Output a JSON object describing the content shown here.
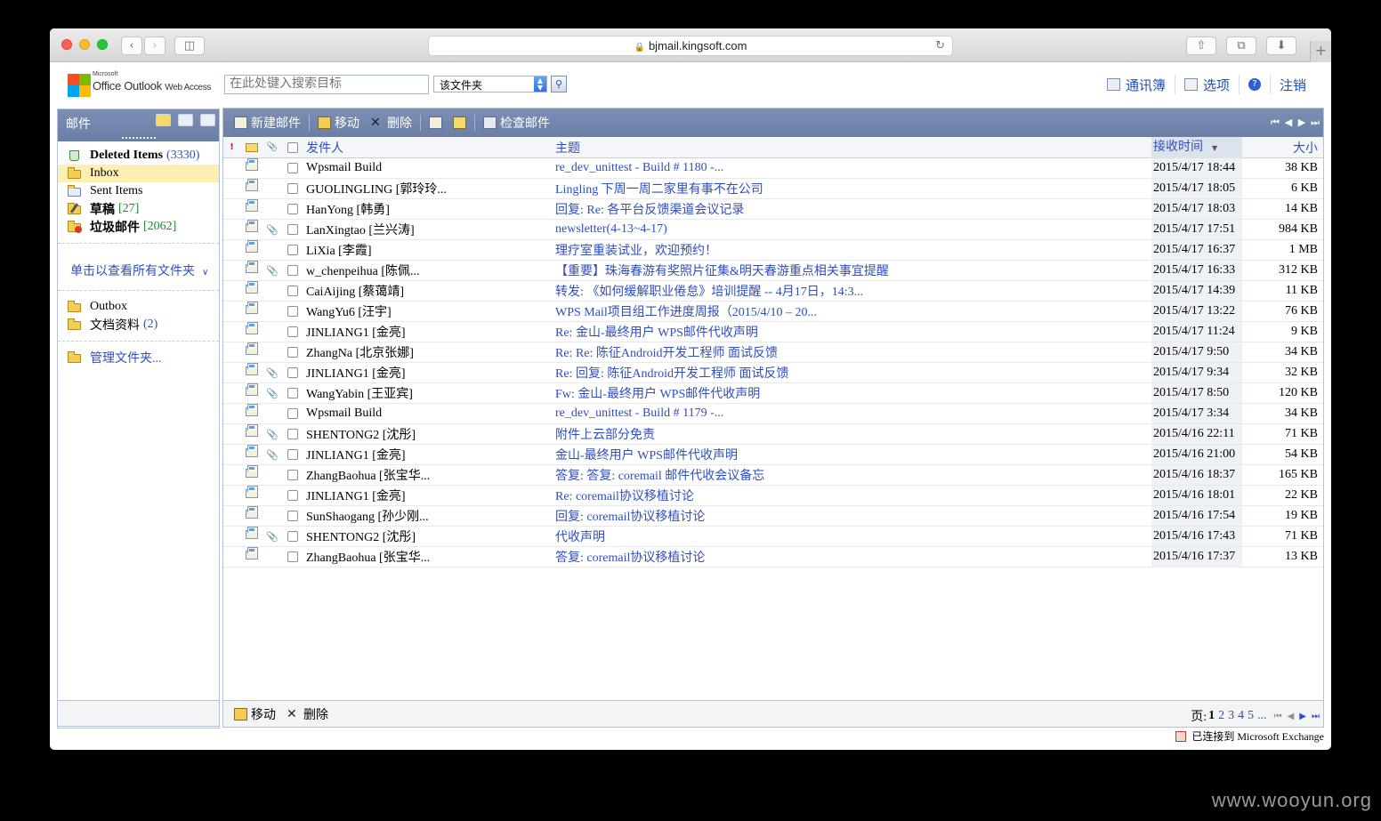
{
  "browser": {
    "url": "bjmail.kingsoft.com"
  },
  "brand": {
    "ms_label": "Microsoft",
    "name": "Office Outlook",
    "sub": "Web Access"
  },
  "search": {
    "placeholder": "在此处键入搜索目标",
    "scope": "该文件夹"
  },
  "top_links": [
    {
      "label": "通讯簿",
      "icon": "address-book-icon"
    },
    {
      "label": "选项",
      "icon": "options-icon"
    },
    {
      "label": "",
      "icon": "help-icon"
    },
    {
      "label": "注销",
      "icon": ""
    }
  ],
  "leftnav": {
    "title": "邮件",
    "folders": [
      {
        "name": "Deleted Items",
        "count": "(3330)",
        "bold": true,
        "icon": "recycle-bin-icon",
        "count_color": "blue"
      },
      {
        "name": "Inbox",
        "count": "",
        "bold": false,
        "selected": true,
        "icon": "inbox-icon"
      },
      {
        "name": "Sent Items",
        "count": "",
        "bold": false,
        "icon": "sent-items-icon"
      },
      {
        "name": "草稿",
        "count": "[27]",
        "bold": true,
        "icon": "drafts-icon",
        "count_color": "green"
      },
      {
        "name": "垃圾邮件",
        "count": "[2062]",
        "bold": true,
        "icon": "junk-mail-icon",
        "count_color": "green"
      }
    ],
    "all_folders_label": "单击以查看所有文件夹",
    "extra_folders": [
      {
        "name": "Outbox",
        "count": "",
        "icon": "folder-icon"
      },
      {
        "name": "文档资料",
        "count": "(2)",
        "icon": "folder-icon"
      }
    ],
    "manage_label": "管理文件夹..."
  },
  "toolbar": {
    "new_mail": "新建邮件",
    "move": "移动",
    "delete": "删除",
    "check_mail": "检查邮件"
  },
  "columns": {
    "from": "发件人",
    "subject": "主题",
    "received": "接收时间",
    "size": "大小"
  },
  "messages": [
    {
      "from": "Wpsmail Build",
      "subject": "re_dev_unittest - Build # 1180 -...",
      "date": "2015/4/17 18:44",
      "size": "38 KB",
      "attach": false
    },
    {
      "from": "GUOLINGLING [郭玲玲...",
      "subject": "Lingling 下周一周二家里有事不在公司",
      "date": "2015/4/17 18:05",
      "size": "6 KB",
      "attach": false
    },
    {
      "from": "HanYong [韩勇]",
      "subject": "回复: Re: 各平台反馈渠道会议记录",
      "date": "2015/4/17 18:03",
      "size": "14 KB",
      "attach": false
    },
    {
      "from": "LanXingtao [兰兴涛]",
      "subject": "newsletter(4-13~4-17)",
      "date": "2015/4/17 17:51",
      "size": "984 KB",
      "attach": true
    },
    {
      "from": "LiXia [李霞]",
      "subject": "理疗室重装试业，欢迎预约！",
      "date": "2015/4/17 16:37",
      "size": "1 MB",
      "attach": false
    },
    {
      "from": "w_chenpeihua [陈佩...",
      "subject": "【重要】珠海春游有奖照片征集&明天春游重点相关事宜提醒",
      "date": "2015/4/17 16:33",
      "size": "312 KB",
      "attach": true
    },
    {
      "from": "CaiAijing [蔡蔼靖]",
      "subject": "转发: 《如何缓解职业倦怠》培训提醒 -- 4月17日，14:3...",
      "date": "2015/4/17 14:39",
      "size": "11 KB",
      "attach": false
    },
    {
      "from": "WangYu6 [汪宇]",
      "subject": "WPS Mail项目组工作进度周报（2015/4/10 – 20...",
      "date": "2015/4/17 13:22",
      "size": "76 KB",
      "attach": false
    },
    {
      "from": "JINLIANG1 [金亮]",
      "subject": "Re: 金山-最终用户 WPS邮件代收声明",
      "date": "2015/4/17 11:24",
      "size": "9 KB",
      "attach": false
    },
    {
      "from": "ZhangNa [北京张娜]",
      "subject": "Re: Re: 陈征Android开发工程师 面试反馈",
      "date": "2015/4/17 9:50",
      "size": "34 KB",
      "attach": false
    },
    {
      "from": "JINLIANG1 [金亮]",
      "subject": "Re: 回复: 陈征Android开发工程师 面试反馈",
      "date": "2015/4/17 9:34",
      "size": "32 KB",
      "attach": true
    },
    {
      "from": "WangYabin [王亚宾]",
      "subject": "Fw: 金山-最终用户 WPS邮件代收声明",
      "date": "2015/4/17 8:50",
      "size": "120 KB",
      "attach": true
    },
    {
      "from": "Wpsmail Build",
      "subject": "re_dev_unittest - Build # 1179 -...",
      "date": "2015/4/17 3:34",
      "size": "34 KB",
      "attach": false
    },
    {
      "from": "SHENTONG2 [沈彤]",
      "subject": "附件上云部分免责",
      "date": "2015/4/16 22:11",
      "size": "71 KB",
      "attach": true
    },
    {
      "from": "JINLIANG1 [金亮]",
      "subject": "金山-最终用户 WPS邮件代收声明",
      "date": "2015/4/16 21:00",
      "size": "54 KB",
      "attach": true
    },
    {
      "from": "ZhangBaohua [张宝华...",
      "subject": "答复: 答复: coremail 邮件代收会议备忘",
      "date": "2015/4/16 18:37",
      "size": "165 KB",
      "attach": false
    },
    {
      "from": "JINLIANG1 [金亮]",
      "subject": "Re: coremail协议移植讨论",
      "date": "2015/4/16 18:01",
      "size": "22 KB",
      "attach": false
    },
    {
      "from": "SunShaogang [孙少刚...",
      "subject": "回复: coremail协议移植讨论",
      "date": "2015/4/16 17:54",
      "size": "19 KB",
      "attach": false
    },
    {
      "from": "SHENTONG2 [沈彤]",
      "subject": "代收声明",
      "date": "2015/4/16 17:43",
      "size": "71 KB",
      "attach": true
    },
    {
      "from": "ZhangBaohua [张宝华...",
      "subject": "答复: coremail协议移植讨论",
      "date": "2015/4/16 17:37",
      "size": "13 KB",
      "attach": false
    }
  ],
  "bottom": {
    "move": "移动",
    "delete": "删除",
    "page_label": "页:",
    "pages": [
      "1",
      "2",
      "3",
      "4",
      "5",
      "..."
    ],
    "current_page": "1"
  },
  "status": "已连接到 Microsoft Exchange",
  "watermark": "www.wooyun.org"
}
